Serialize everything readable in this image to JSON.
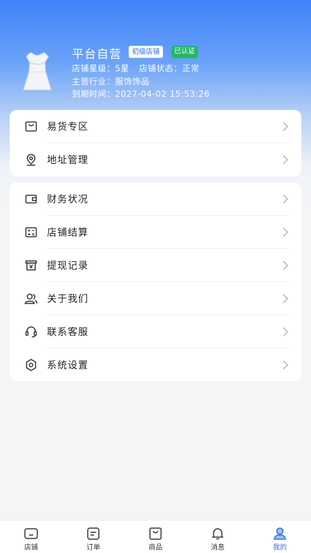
{
  "profile": {
    "shop_name": "平台自营",
    "level_badge": "初级店铺",
    "verified_badge": "已认证",
    "rating_label": "店铺星级：",
    "rating_value": "5星",
    "status_label": "店铺状态：",
    "status_value": "正常",
    "industry_label": "主营行业：",
    "industry_value": "服饰饰品",
    "expiry_label": "到期时间：",
    "expiry_value": "2027-04-02 15:53:26"
  },
  "menu_group_1": [
    {
      "label": "易货专区",
      "icon": "bag-icon"
    },
    {
      "label": "地址管理",
      "icon": "location-pin-icon"
    }
  ],
  "menu_group_2": [
    {
      "label": "财务状况",
      "icon": "wallet-icon"
    },
    {
      "label": "店铺结算",
      "icon": "calculator-icon"
    },
    {
      "label": "提现记录",
      "icon": "withdraw-icon"
    },
    {
      "label": "关于我们",
      "icon": "users-icon"
    },
    {
      "label": "联系客服",
      "icon": "headset-icon"
    },
    {
      "label": "系统设置",
      "icon": "gear-icon"
    }
  ],
  "tabbar": [
    {
      "label": "店铺",
      "icon": "shop-icon",
      "active": false
    },
    {
      "label": "订单",
      "icon": "order-icon",
      "active": false
    },
    {
      "label": "商品",
      "icon": "goods-icon",
      "active": false
    },
    {
      "label": "消息",
      "icon": "bell-icon",
      "active": false
    },
    {
      "label": "我的",
      "icon": "user-icon",
      "active": true
    }
  ],
  "colors": {
    "primary": "#2f6fe8",
    "verified": "#22b86a",
    "header_top": "#3e82f7",
    "background": "#f4f5f7"
  }
}
